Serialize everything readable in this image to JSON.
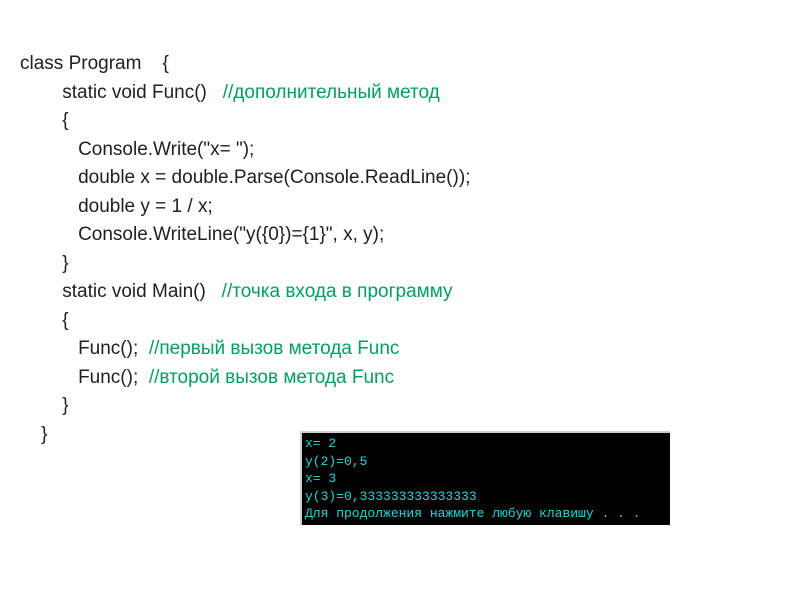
{
  "code": {
    "l1a": "class Program    {",
    "l2a": "        static void Func()   ",
    "l2c": "//дополнительный метод",
    "l3": "        {",
    "l4": "           Console.Write(\"x= \");",
    "l5": "           double x = double.Parse(Console.ReadLine());",
    "l6": "           double y = 1 / x;",
    "l7": "           Console.WriteLine(\"y({0})={1}\", x, y);",
    "l8": "        }",
    "l9a": "        static void Main()   ",
    "l9c": "//точка входа в программу",
    "l10": "        {",
    "l11a": "           Func();  ",
    "l11c": "//первый вызов метода Func",
    "l12a": "           Func();  ",
    "l12c": "//второй вызов метода Func",
    "l13": "        }",
    "l14": "    }"
  },
  "console": {
    "l1": "x= 2",
    "l2": "y(2)=0,5",
    "l3": "x= 3",
    "l4": "y(3)=0,333333333333333",
    "l5": "Для продолжения нажмите любую клавишу . . ."
  }
}
